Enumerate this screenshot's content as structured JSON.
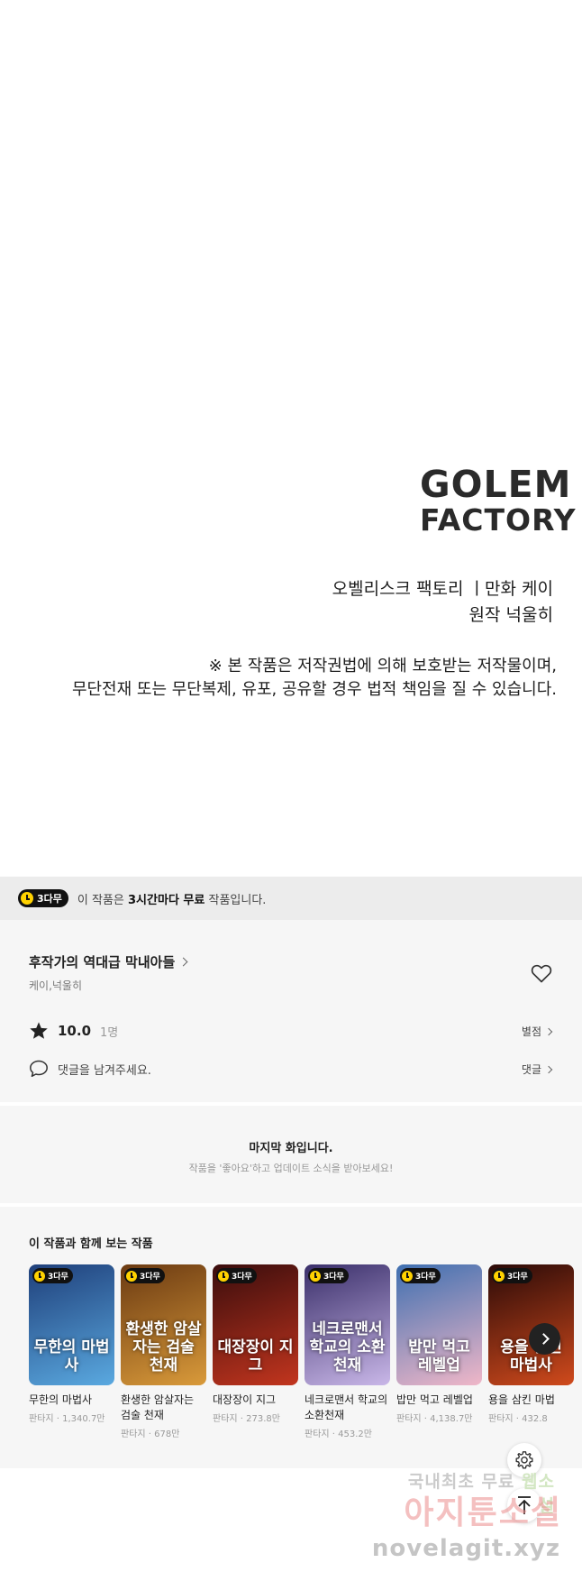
{
  "credits": {
    "logo_line1": "GOLEM",
    "logo_line2": "FACTORY",
    "studio_line": "오벨리스크 팩토리 ㅣ만화 케이",
    "original_line": "원작 넉울히",
    "notice_line1": "※ 본 작품은 저작권법에 의해 보호받는 저작물이며,",
    "notice_line2": "무단전재 또는 무단복제, 유포, 공유할 경우 법적 책임을 질 수 있습니다."
  },
  "free_banner": {
    "badge": "3다무",
    "text_pre": "이 작품은 ",
    "text_bold": "3시간마다 무료",
    "text_post": " 작품입니다."
  },
  "series": {
    "title": "후작가의 역대급 막내아들",
    "authors": "케이,넉울히",
    "rating": "10.0",
    "rating_count": "1명",
    "rate_link": "별점",
    "comment_placeholder": "댓글을 남겨주세요.",
    "comment_link": "댓글"
  },
  "last_episode": {
    "title": "마지막 화입니다.",
    "subtitle": "작품을 '좋아요'하고 업데이트 소식을 받아보세요!"
  },
  "recommendations": {
    "heading": "이 작품과 함께 보는 작품",
    "items": [
      {
        "badge": "3다무",
        "art": "무한의 마법사",
        "name": "무한의 마법사",
        "meta": "판타지 · 1,340.7만",
        "colors": [
          "#1f3f7a",
          "#5aa9e0"
        ]
      },
      {
        "badge": "3다무",
        "art": "환생한 암살자는 검술 천재",
        "name": "환생한 암살자는 검술 천재",
        "meta": "판타지 · 678만",
        "colors": [
          "#6b3a12",
          "#d99a3a"
        ]
      },
      {
        "badge": "3다무",
        "art": "대장장이 지그",
        "name": "대장장이 지그",
        "meta": "판타지 · 273.8만",
        "colors": [
          "#3a0d0d",
          "#c2351e"
        ]
      },
      {
        "badge": "3다무",
        "art": "네크로맨서 학교의 소환천재",
        "name": "네크로맨서 학교의 소환천재",
        "meta": "판타지 · 453.2만",
        "colors": [
          "#3a2f6a",
          "#c9b7e8"
        ]
      },
      {
        "badge": "3다무",
        "art": "밥만 먹고 레벨업",
        "name": "밥만 먹고 레벨업",
        "meta": "판타지 · 4,138.7만",
        "colors": [
          "#3e6fb0",
          "#f0b7c8"
        ]
      },
      {
        "badge": "3다무",
        "art": "용을 삼킨 마법사",
        "name": "용을 삼킨 마법",
        "meta": "판타지 · 432.8",
        "colors": [
          "#2a0a08",
          "#d04a1c"
        ]
      }
    ]
  },
  "watermark": {
    "line1_a": "국내최초 무료 ",
    "line1_b": "웹소설",
    "line2": "아지툰소설",
    "line3": "novelagit.xyz"
  },
  "icons": {
    "heart": "heart-icon",
    "star": "star-icon",
    "comment": "speech-bubble-icon",
    "settings": "gear-icon",
    "scroll_top": "arrow-up-icon",
    "next": "chevron-right-icon",
    "clock": "clock-icon"
  }
}
